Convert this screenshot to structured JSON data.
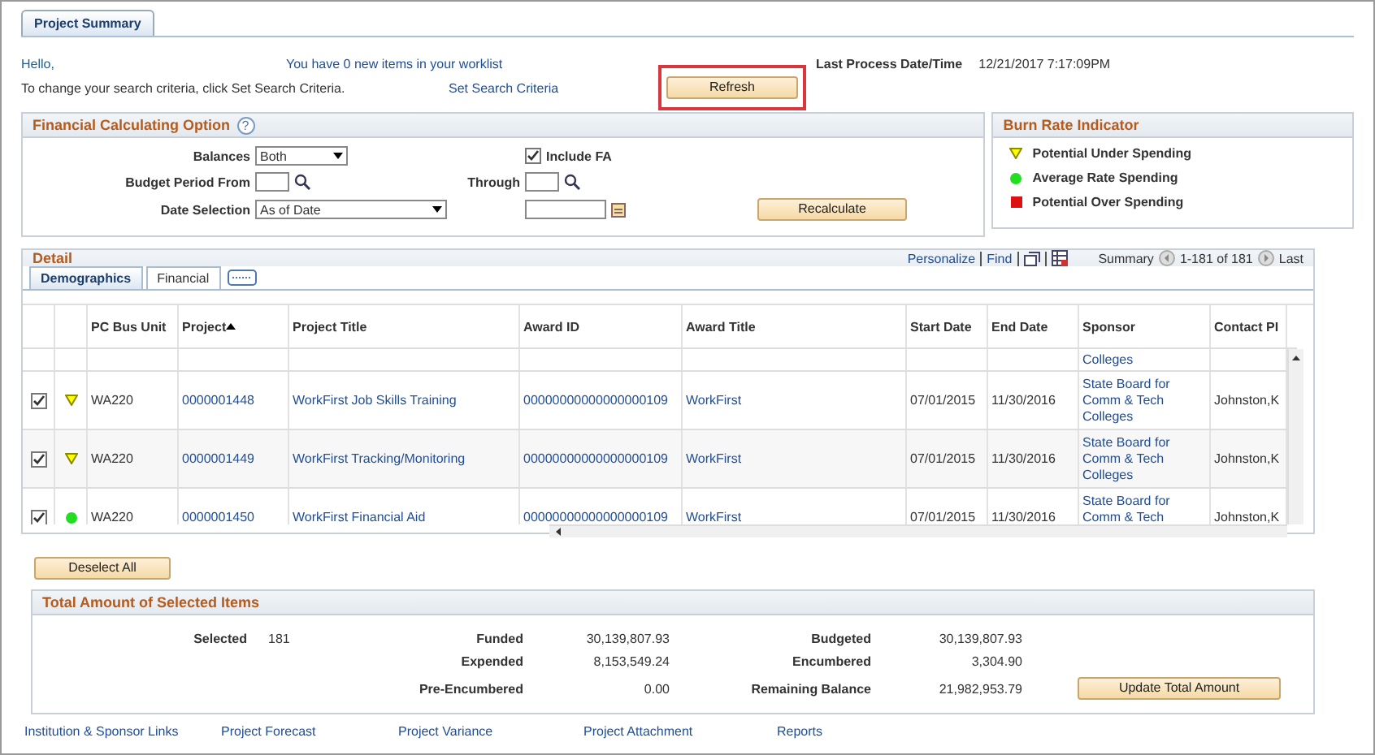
{
  "page_tab": {
    "label": "Project Summary",
    "selected": true
  },
  "greeting": "Hello,",
  "worklist_link": "You have 0 new items in your worklist",
  "last_process": {
    "label": "Last Process Date/Time",
    "value": "12/21/2017  7:17:09PM"
  },
  "search_hint": "To change your search criteria, click Set Search Criteria.",
  "search_link": "Set Search Criteria",
  "refresh_button": {
    "label": "Refresh",
    "highlighted": true
  },
  "financial_option": {
    "title": "Financial Calculating Option",
    "help": "?",
    "balances": {
      "label": "Balances",
      "value": "Both"
    },
    "include_fa": {
      "label": "Include FA",
      "checked": true
    },
    "budget_period_from": {
      "label": "Budget Period From"
    },
    "through": {
      "label": "Through"
    },
    "date_selection": {
      "label": "Date Selection",
      "value": "As of Date"
    },
    "recalculate_button": "Recalculate"
  },
  "burn_rate": {
    "title": "Burn Rate Indicator",
    "items": [
      {
        "kind": "under",
        "label": "Potential Under Spending"
      },
      {
        "kind": "average",
        "label": "Average Rate Spending"
      },
      {
        "kind": "over",
        "label": "Potential Over Spending"
      }
    ]
  },
  "detail": {
    "title": "Detail",
    "toolbar": [
      "Personalize",
      "Find"
    ],
    "summary_label": "Summary",
    "range": "1-181 of 181",
    "last": "Last",
    "tabs": [
      {
        "label": "Demographics",
        "selected": true
      },
      {
        "label": "Financial",
        "selected": false
      }
    ],
    "columns": [
      "PC Bus Unit",
      "Project",
      "Project Title",
      "Award ID",
      "Award Title",
      "Start Date",
      "End Date",
      "Sponsor",
      "Contact PI"
    ],
    "partial_row": {
      "sponsor": "Colleges"
    },
    "rows": [
      {
        "selected": true,
        "kind": "under",
        "bus_unit": "WA220",
        "project": "0000001448",
        "title": "WorkFirst Job Skills Training",
        "award_id": "00000000000000000109",
        "award_title": "WorkFirst",
        "start": "07/01/2015",
        "end": "11/30/2016",
        "sponsor": "State Board for Comm & Tech Colleges",
        "contact": "Johnston,K"
      },
      {
        "selected": true,
        "kind": "under",
        "bus_unit": "WA220",
        "project": "0000001449",
        "title": "WorkFirst Tracking/Monitoring",
        "award_id": "00000000000000000109",
        "award_title": "WorkFirst",
        "start": "07/01/2015",
        "end": "11/30/2016",
        "sponsor": "State Board for Comm & Tech Colleges",
        "contact": "Johnston,K"
      },
      {
        "selected": true,
        "kind": "average",
        "bus_unit": "WA220",
        "project": "0000001450",
        "title": "WorkFirst Financial Aid",
        "award_id": "00000000000000000109",
        "award_title": "WorkFirst",
        "start": "07/01/2015",
        "end": "11/30/2016",
        "sponsor": "State Board for Comm & Tech",
        "contact": "Johnston,K"
      }
    ]
  },
  "deselect_button": "Deselect All",
  "totals": {
    "title": "Total Amount of Selected Items",
    "selected": {
      "label": "Selected",
      "value": "181"
    },
    "left": [
      {
        "label": "Funded",
        "value": "30,139,807.93"
      },
      {
        "label": "Expended",
        "value": "8,153,549.24"
      },
      {
        "label": "Pre-Encumbered",
        "value": "0.00"
      }
    ],
    "right": [
      {
        "label": "Budgeted",
        "value": "30,139,807.93"
      },
      {
        "label": "Encumbered",
        "value": "3,304.90"
      },
      {
        "label": "Remaining Balance",
        "value": "21,982,953.79"
      }
    ],
    "update_button": "Update Total Amount"
  },
  "footer_links": [
    "Institution & Sponsor Links",
    "Project Forecast",
    "Project Variance",
    "Project Attachment",
    "Reports"
  ]
}
